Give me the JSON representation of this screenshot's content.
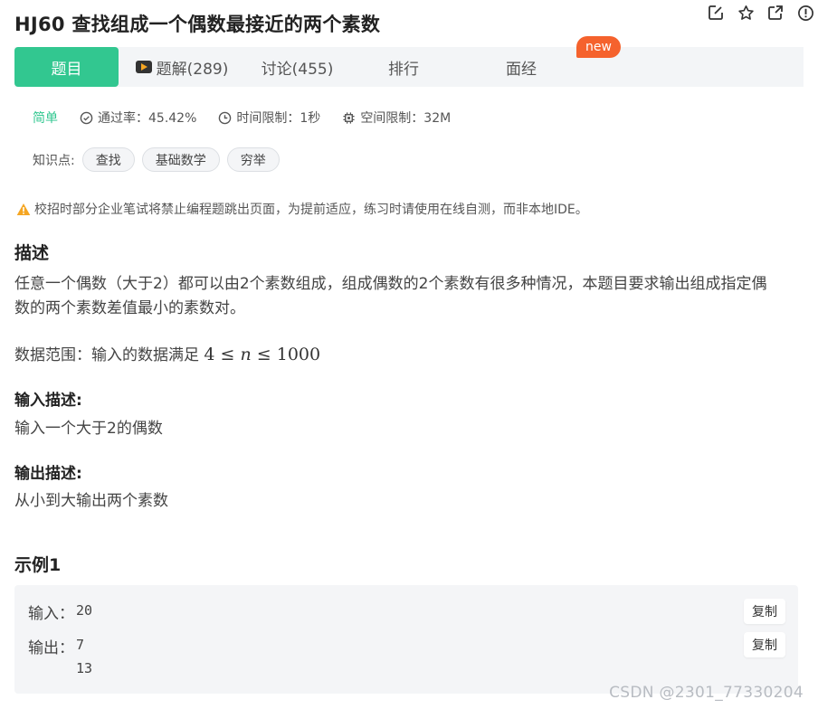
{
  "problem": {
    "title": "HJ60  查找组成一个偶数最接近的两个素数"
  },
  "title_icons": [
    "edit-icon",
    "star-icon",
    "share-icon",
    "report-icon"
  ],
  "tabs": [
    {
      "label": "题目"
    },
    {
      "label": "题解(289)"
    },
    {
      "label": "讨论(455)"
    },
    {
      "label": "排行"
    },
    {
      "label": "面经"
    }
  ],
  "new_badge": "new",
  "meta": {
    "difficulty": "简单",
    "pass_rate": "通过率：45.42%",
    "time_limit": "时间限制：1秒",
    "memory_limit": "空间限制：32M"
  },
  "tags": {
    "label": "知识点:",
    "items": [
      "查找",
      "基础数学",
      "穷举"
    ]
  },
  "warning": "校招时部分企业笔试将禁止编程题跳出页面，为提前适应，练习时请使用在线自测，而非本地IDE。",
  "description": {
    "heading": "描述",
    "line1": "任意一个偶数（大于2）都可以由2个素数组成，组成偶数的2个素数有很多种情况，本题目要求输出组成指定偶",
    "line2": "数的两个素数差值最小的素数对。",
    "range_label": "数据范围：输入的数据满足",
    "range_low": "4",
    "range_var": "n",
    "range_high": "1000"
  },
  "input_desc": {
    "heading": "输入描述:",
    "text": "输入一个大于2的偶数"
  },
  "output_desc": {
    "heading": "输出描述:",
    "text": "从小到大输出两个素数"
  },
  "example": {
    "heading": "示例1",
    "input_label": "输入：",
    "input_value": "20",
    "output_label": "输出：",
    "output_line1": "7",
    "output_line2": "13",
    "copy_label": "复制"
  },
  "watermark": "CSDN @2301_77330204",
  "colors": {
    "accent": "#32c790",
    "badge": "#f5622d",
    "warning": "#f5a623"
  }
}
